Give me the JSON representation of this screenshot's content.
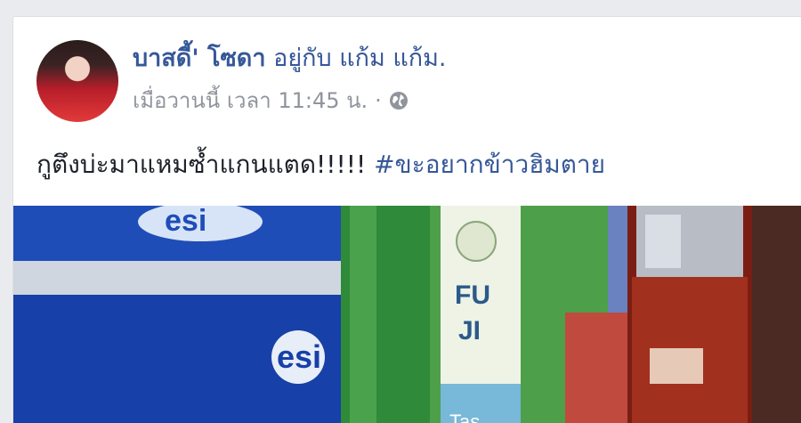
{
  "post": {
    "author": "บาสดี้' โซดา",
    "with_text": "อยู่กับ",
    "tagged": "แก้ม แก้ม.",
    "timestamp": "เมื่อวานนี้ เวลา 11:45 น.",
    "separator": "·",
    "privacy_icon": "globe-icon",
    "text": "กูตึงบ่ะมาแหมซ้ำแกนแตด!!!!! ",
    "hashtag": "#ขะอยากข้าวฮิมตาย"
  },
  "photo": {
    "cooler_brand": "esi",
    "bottle_label_lines": [
      "FU",
      "JI"
    ],
    "bottle_label_bottom": "Tas"
  },
  "colors": {
    "link": "#365899",
    "meta": "#90949c",
    "text": "#1d2129",
    "background": "#e9ebee"
  }
}
